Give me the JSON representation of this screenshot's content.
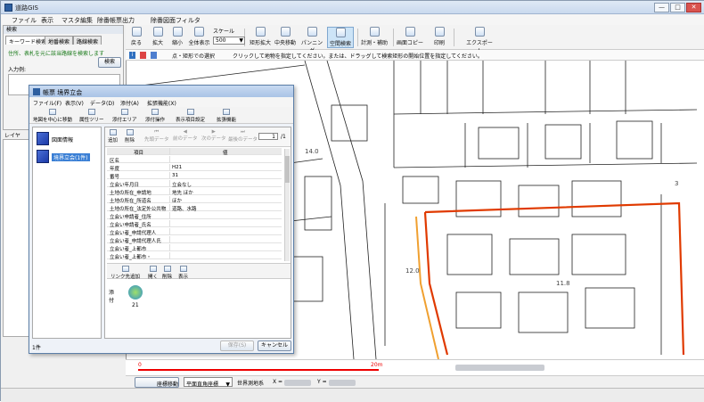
{
  "window": {
    "title": "道路GIS",
    "min": "—",
    "max": "□",
    "close": "✕"
  },
  "menu": [
    "ファイル",
    "表示",
    "マスタ編集",
    "除番帳票出力",
    "除番図面フィルタ"
  ],
  "toolbar": {
    "buttons": [
      {
        "label": "戻る",
        "icon": "back-icon"
      },
      {
        "label": "拡大",
        "icon": "zoom-in-icon"
      },
      {
        "label": "縮小",
        "icon": "zoom-out-icon"
      },
      {
        "label": "全体表示",
        "icon": "full-extent-icon"
      },
      {
        "label": "矩形拡大",
        "icon": "rect-zoom-icon"
      },
      {
        "label": "中央移動",
        "icon": "center-move-icon"
      },
      {
        "label": "パンニング",
        "icon": "pan-icon"
      },
      {
        "label": "空間検索",
        "icon": "spatial-search-icon"
      },
      {
        "label": "計測・補助",
        "icon": "measure-icon"
      },
      {
        "label": "画面コピー",
        "icon": "screen-copy-icon"
      },
      {
        "label": "印刷",
        "icon": "print-icon"
      },
      {
        "label": "エクスポート",
        "icon": "export-icon"
      }
    ],
    "scale_label": "スケール",
    "scale_value": "500"
  },
  "info": {
    "mode": "点・矩形での選択",
    "message": "クリックして地物を指定してください。または、ドラッグして検索矩形の開始位置を指定してください。"
  },
  "left_panel": {
    "title": "検索",
    "tabs": [
      "キーワード検索",
      "地番検索",
      "路線検索"
    ],
    "hint": "住所、表札を元に該当路線を検索します",
    "search_button": "検索",
    "input_label": "入力例:",
    "layer_title": "レイヤ"
  },
  "dialog": {
    "title": "帳票 境界立会",
    "menu": [
      "ファイル(F)",
      "表示(V)",
      "データ(D)",
      "添付(A)",
      "拡張機能(X)"
    ],
    "tools": [
      "地図を中心に移動",
      "属性ツリー",
      "添付エリア",
      "添付操作",
      "表示項目設定",
      "拡張機能"
    ],
    "list": [
      {
        "label": "図面情報"
      },
      {
        "label": "境界立会(1件)"
      }
    ],
    "record_tools": [
      "追加",
      "削除",
      "先頭データ",
      "前のデータ",
      "次のデータ",
      "最後のデータ"
    ],
    "page_current": "1",
    "page_total": "/1",
    "grid_headers": [
      "項目",
      "値"
    ],
    "rows": [
      {
        "key": "区名",
        "value": ""
      },
      {
        "key": "年度",
        "value": "H21"
      },
      {
        "key": "番号",
        "value": "31"
      },
      {
        "key": "立会い年月日",
        "value": "立会なし"
      },
      {
        "key": "土地の所在_申請地",
        "value": "地先 ほか"
      },
      {
        "key": "土地の所在_所道名",
        "value": "ほか"
      },
      {
        "key": "土地の所在_法定外公共物",
        "value": "道路、水路"
      },
      {
        "key": "立会い申請者_住所",
        "value": ""
      },
      {
        "key": "立会い申請者_氏名",
        "value": ""
      },
      {
        "key": "立会い者_申請代理人",
        "value": ""
      },
      {
        "key": "立会い者_申請代理人氏",
        "value": ""
      },
      {
        "key": "立会い者_上都市",
        "value": ""
      },
      {
        "key": "立会い者_上都市・",
        "value": ""
      }
    ],
    "attach_tools": [
      "リンク先追加",
      "開く",
      "削除",
      "表示"
    ],
    "attach_label": "添付",
    "attach_item": "21",
    "save_button": "保存(S)",
    "cancel_button": "キャンセル",
    "status": "1件"
  },
  "map": {
    "labels": [
      "14.0",
      "12.0",
      "11.8",
      "3"
    ]
  },
  "scalebar": {
    "zero": "0",
    "end": "20m"
  },
  "status": {
    "coord_button": "座標移動",
    "coord_system": "平面直角座標",
    "world": "世界測地系",
    "x_label": "X =",
    "y_label": "Y ="
  }
}
